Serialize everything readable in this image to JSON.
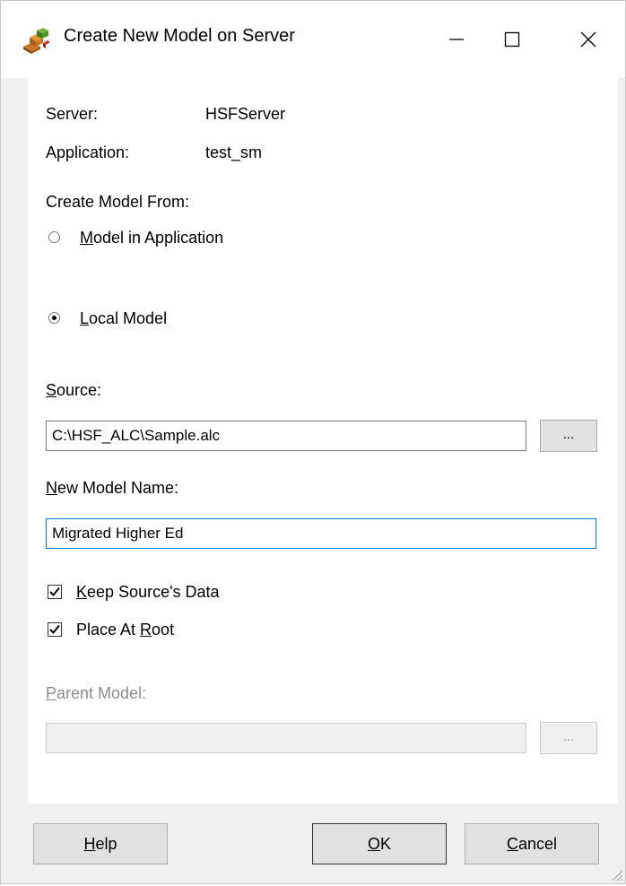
{
  "window": {
    "title": "Create New Model on Server",
    "icon": "app-blocks-icon",
    "controls": [
      "minimize-icon",
      "maximize-icon",
      "close-icon"
    ]
  },
  "info": {
    "server_label": "Server:",
    "server_value": "HSFServer",
    "application_label": "Application:",
    "application_value": "test_sm"
  },
  "create_from": {
    "label": "Create Model From:",
    "option_model_in_app": {
      "mnemonic": "M",
      "rest": "odel in Application",
      "checked": false
    },
    "option_local_model": {
      "mnemonic": "L",
      "rest": "ocal Model",
      "checked": true
    }
  },
  "source": {
    "label_mnemonic": "S",
    "label_rest": "ource:",
    "value": "C:\\HSF_ALC\\Sample.alc",
    "browse_label": "..."
  },
  "new_model_name": {
    "label_mnemonic": "N",
    "label_rest": "ew Model Name:",
    "value": "Migrated Higher Ed"
  },
  "options": {
    "keep_source_data": {
      "mnemonic": "K",
      "rest": "eep Source's Data",
      "checked": true
    },
    "place_at_root": {
      "prefix": "Place At ",
      "mnemonic": "R",
      "rest": "oot",
      "checked": true
    }
  },
  "parent_model": {
    "label_mnemonic": "P",
    "label_rest": "arent Model:",
    "value": "",
    "browse_label": "...",
    "enabled": false
  },
  "buttons": {
    "help": {
      "mnemonic": "H",
      "rest": "elp"
    },
    "ok": {
      "mnemonic": "O",
      "rest": "K"
    },
    "cancel": {
      "mnemonic": "C",
      "rest": "ancel"
    }
  },
  "colors": {
    "focus_border": "#0078d7",
    "disabled_text": "#8c8c8c",
    "dialog_bg": "#f0f0f0"
  }
}
